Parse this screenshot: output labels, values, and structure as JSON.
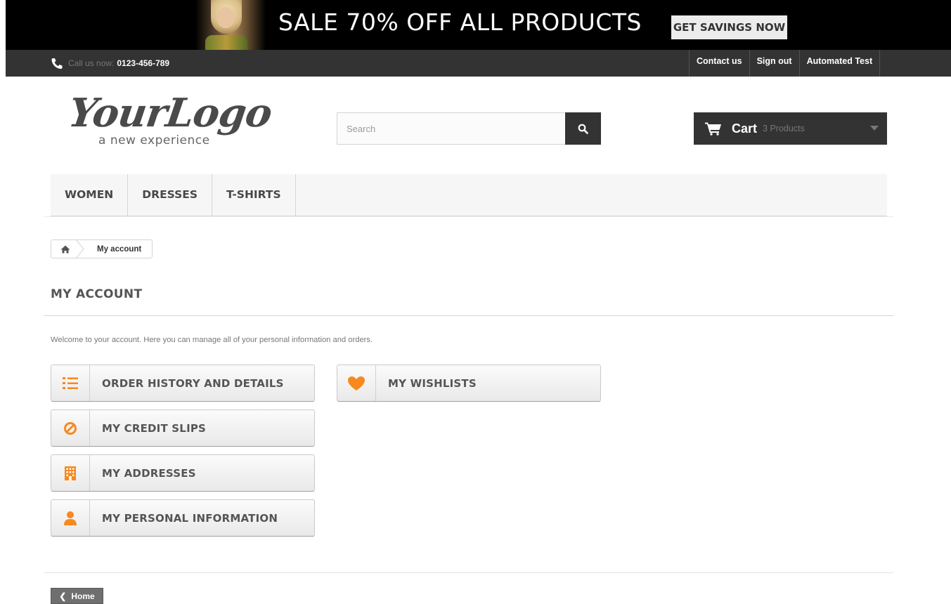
{
  "banner": {
    "title": "SALE 70% OFF ALL PRODUCTS",
    "button_label": "GET SAVINGS NOW"
  },
  "topbar": {
    "phone_prefix": "Call us now:",
    "phone_number": "0123-456-789",
    "links": [
      "Contact us",
      "Sign out",
      "Automated Test"
    ]
  },
  "header": {
    "logo_text": "YourLogo",
    "logo_tagline": "a new experience",
    "search_placeholder": "Search",
    "cart_label": "Cart",
    "cart_count": "3 Products"
  },
  "menu": {
    "items": [
      "WOMEN",
      "DRESSES",
      "T-SHIRTS"
    ]
  },
  "breadcrumb": {
    "current": "My account"
  },
  "page": {
    "title": "MY ACCOUNT",
    "welcome": "Welcome to your account. Here you can manage all of your personal information and orders."
  },
  "account_links": [
    {
      "label": "ORDER HISTORY AND DETAILS",
      "icon": "list-ol-icon"
    },
    {
      "label": "MY WISHLISTS",
      "icon": "heart-icon"
    },
    {
      "label": "MY CREDIT SLIPS",
      "icon": "ban-icon"
    },
    {
      "label": "MY ADDRESSES",
      "icon": "building-icon"
    },
    {
      "label": "MY PERSONAL INFORMATION",
      "icon": "user-icon"
    }
  ],
  "footer": {
    "home_label": "Home"
  },
  "colors": {
    "accent": "#f7891f",
    "dark": "#333333",
    "menu_bg": "#f6f6f6"
  }
}
